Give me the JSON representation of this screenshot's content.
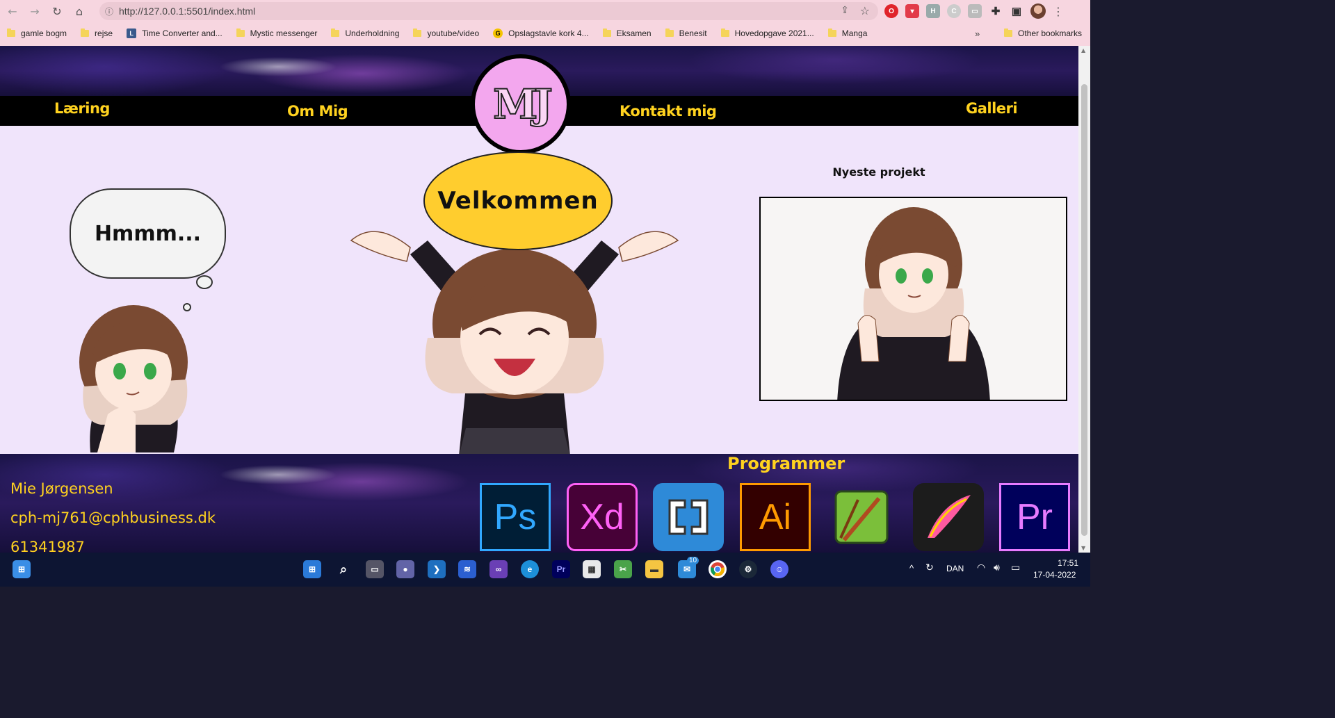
{
  "browser": {
    "url": "http://127.0.0.1:5501/index.html",
    "bookmarks": [
      {
        "label": "gamle bogm",
        "icon": "folder"
      },
      {
        "label": "rejse",
        "icon": "folder"
      },
      {
        "label": "Time Converter and...",
        "icon": "site"
      },
      {
        "label": "Mystic messenger",
        "icon": "folder"
      },
      {
        "label": "Underholdning",
        "icon": "folder"
      },
      {
        "label": "youtube/video",
        "icon": "folder"
      },
      {
        "label": "Opslagstavle kork 4...",
        "icon": "site"
      },
      {
        "label": "Eksamen",
        "icon": "folder"
      },
      {
        "label": "Benesit",
        "icon": "folder"
      },
      {
        "label": "Hovedopgave 2021...",
        "icon": "folder"
      },
      {
        "label": "Manga",
        "icon": "folder"
      }
    ],
    "more_label": "»",
    "other_bookmarks": "Other bookmarks"
  },
  "nav": {
    "items": [
      "Læring",
      "Om Mig",
      "Kontakt mig",
      "Galleri"
    ],
    "logo": "MJ"
  },
  "hero": {
    "welcome": "Velkommen",
    "thought": "Hmmm..."
  },
  "newest": {
    "title": "Nyeste projekt"
  },
  "footer": {
    "name": "Mie Jørgensen",
    "email": "cph-mj761@cphbusiness.dk",
    "phone": "61341987",
    "programs_title": "Programmer",
    "programs": [
      {
        "label": "Ps",
        "color": "#31a8ff",
        "bg": "#001e36"
      },
      {
        "label": "Xd",
        "color": "#ff61f6",
        "bg": "#470137"
      },
      {
        "label": "Brackets",
        "color": "#ffffff",
        "bg": "#2e8ad8"
      },
      {
        "label": "Ai",
        "color": "#ff9a00",
        "bg": "#330000"
      },
      {
        "label": "Krita",
        "color": "#ffffff",
        "bg": "#7bbf3a"
      },
      {
        "label": "Procreate",
        "color": "#ffffff",
        "bg": "#1c1c1c"
      },
      {
        "label": "Pr",
        "color": "#9999ff",
        "bg": "#00005b"
      }
    ]
  },
  "taskbar": {
    "language": "DAN",
    "time": "17:51",
    "date": "17-04-2022",
    "mail_badge": "10"
  }
}
